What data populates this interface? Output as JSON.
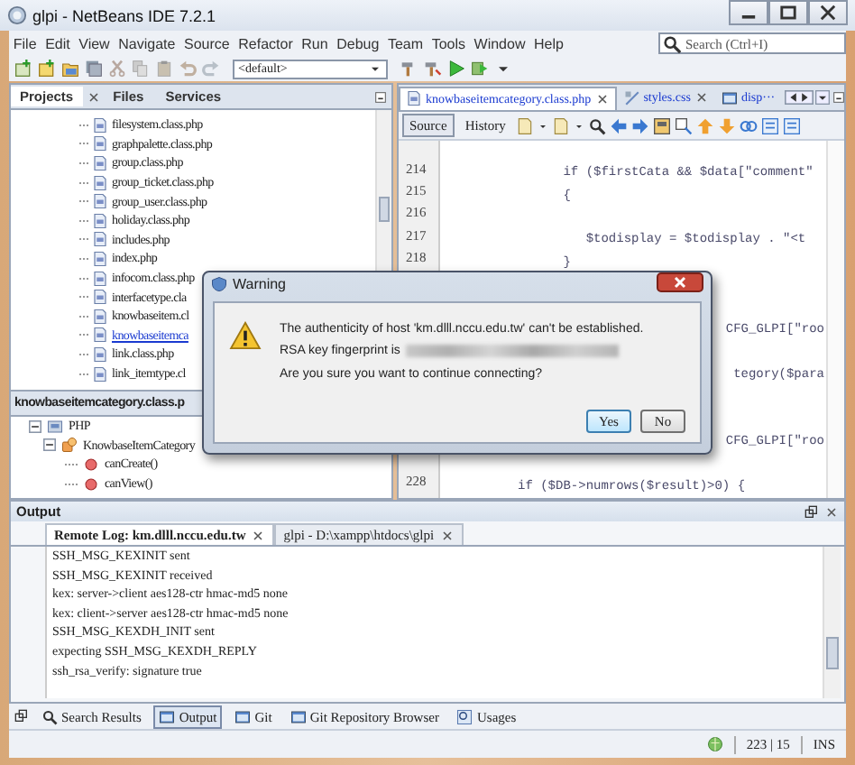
{
  "window": {
    "title": "glpi - NetBeans IDE 7.2.1"
  },
  "menu": [
    "File",
    "Edit",
    "View",
    "Navigate",
    "Source",
    "Refactor",
    "Run",
    "Debug",
    "Team",
    "Tools",
    "Window",
    "Help"
  ],
  "search": {
    "placeholder": "Search (Ctrl+I)"
  },
  "toolbar": {
    "configuration": "<default>"
  },
  "project_panel": {
    "tabs": [
      {
        "label": "Projects",
        "selected": true
      },
      {
        "label": "Files",
        "selected": false
      },
      {
        "label": "Services",
        "selected": false
      }
    ],
    "files": [
      {
        "name": "filesystem.class.php",
        "selected": false
      },
      {
        "name": "graphpalette.class.php",
        "selected": false
      },
      {
        "name": "group.class.php",
        "selected": false
      },
      {
        "name": "group_ticket.class.php",
        "selected": false
      },
      {
        "name": "group_user.class.php",
        "selected": false
      },
      {
        "name": "holiday.class.php",
        "selected": false
      },
      {
        "name": "includes.php",
        "selected": false
      },
      {
        "name": "index.php",
        "selected": false
      },
      {
        "name": "infocom.class.php",
        "selected": false
      },
      {
        "name": "interfacetype.cla",
        "selected": false
      },
      {
        "name": "knowbaseitem.cl",
        "selected": false
      },
      {
        "name": "knowbaseitemca",
        "selected": true
      },
      {
        "name": "link.class.php",
        "selected": false
      },
      {
        "name": "link_itemtype.cl",
        "selected": false
      }
    ]
  },
  "navigator": {
    "title": "knowbaseitemcategory.class.p",
    "tree": [
      {
        "label": "PHP",
        "kind": "folder",
        "expanded": true,
        "children": [
          {
            "label": "KnowbaseItemCategory",
            "kind": "class",
            "expanded": true,
            "children": [
              {
                "label": "canCreate()",
                "kind": "method"
              },
              {
                "label": "canView()",
                "kind": "method"
              }
            ]
          }
        ]
      }
    ]
  },
  "editor": {
    "tabs": [
      {
        "label": "knowbaseitemcategory.class.php",
        "selected": true
      },
      {
        "label": "styles.css",
        "selected": false
      },
      {
        "label": "disp···",
        "selected": false
      }
    ],
    "views": [
      {
        "label": "Source",
        "selected": true
      },
      {
        "label": "History",
        "selected": false
      }
    ],
    "lines": [
      {
        "kind": "code",
        "number": "214",
        "text": "                if ($firstCata && $data[\"comment\""
      },
      {
        "kind": "code",
        "number": "215",
        "text": "                {"
      },
      {
        "kind": "code",
        "number": "216"
      },
      {
        "kind": "code",
        "number": "217",
        "text": "                   $todisplay = $todisplay . \"<t"
      },
      {
        "kind": "code",
        "number": "218",
        "text": "                }"
      },
      {
        "kind": "hidden"
      },
      {
        "kind": "hidden"
      },
      {
        "kind": "fragment",
        "text": "CFG_GLPI[\"roo"
      },
      {
        "kind": "hidden"
      },
      {
        "kind": "fragment",
        "text": "tegory($para"
      },
      {
        "kind": "hidden"
      },
      {
        "kind": "hidden"
      },
      {
        "kind": "fragment",
        "text": "CFG_GLPI[\"roo"
      },
      {
        "kind": "hidden"
      },
      {
        "kind": "code",
        "number": "228",
        "text": "          if ($DB->numrows($result)>0) {"
      }
    ]
  },
  "dialog": {
    "title": "Warning",
    "message": [
      {
        "text": "The authenticity of host 'km.dlll.nccu.edu.tw' can't be established.",
        "redacted": false
      },
      {
        "text": "RSA key fingerprint is",
        "redacted": true
      },
      {
        "text": "Are you sure you want to continue connecting?",
        "redacted": false
      }
    ],
    "buttons": [
      {
        "label": "Yes",
        "selected": true
      },
      {
        "label": "No",
        "selected": false
      }
    ]
  },
  "output": {
    "title": "Output",
    "tabs": [
      {
        "label": "Remote Log: km.dlll.nccu.edu.tw",
        "selected": true
      },
      {
        "label": "glpi - D:\\xampp\\htdocs\\glpi",
        "selected": false
      }
    ],
    "lines": [
      "SSH_MSG_KEXINIT sent",
      "SSH_MSG_KEXINIT received",
      "kex: server->client aes128-ctr hmac-md5 none",
      "kex: client->server aes128-ctr hmac-md5 none",
      "SSH_MSG_KEXDH_INIT sent",
      "expecting SSH_MSG_KEXDH_REPLY",
      "ssh_rsa_verify: signature true"
    ]
  },
  "bottom_tabs": [
    {
      "label": "Search Results",
      "selected": false
    },
    {
      "label": "Output",
      "selected": true
    },
    {
      "label": "Git",
      "selected": false
    },
    {
      "label": "Git Repository Browser",
      "selected": false
    },
    {
      "label": "Usages",
      "selected": false
    }
  ],
  "status_bar": {
    "position": "223 | 15",
    "mode": "INS"
  }
}
